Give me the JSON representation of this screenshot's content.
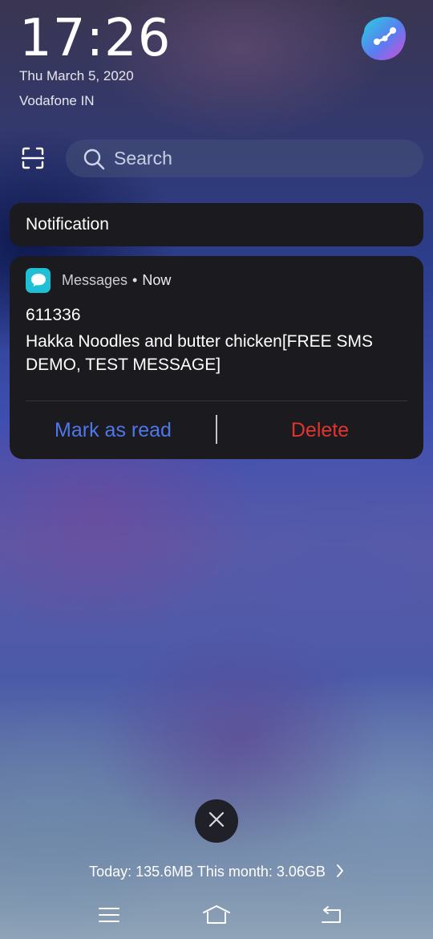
{
  "lockscreen": {
    "time": "17:26",
    "date": "Thu March 5, 2020",
    "carrier": "Vodafone IN"
  },
  "search": {
    "placeholder": "Search"
  },
  "notification_section": {
    "title": "Notification"
  },
  "notification": {
    "app_name": "Messages",
    "separator": "•",
    "time": "Now",
    "sender": "611336",
    "body": "Hakka Noodles and butter chicken[FREE SMS DEMO, TEST MESSAGE]",
    "actions": {
      "mark_read": "Mark as read",
      "delete": "Delete"
    }
  },
  "footer": {
    "data_usage": "Today: 135.6MB This month: 3.06GB"
  },
  "icons": {
    "avatar": "assistant-avatar-icon",
    "scan": "scan-icon",
    "search": "search-icon",
    "app": "messages-app-icon",
    "close": "close-icon",
    "chevron": "chevron-right-icon",
    "menu": "menu-icon",
    "home": "home-icon",
    "back": "back-icon"
  },
  "colors": {
    "mark_read": "#4f76ea",
    "delete": "#e0352f",
    "app_icon": "#1fc0d6",
    "card_bg": "#1b1b1f"
  }
}
